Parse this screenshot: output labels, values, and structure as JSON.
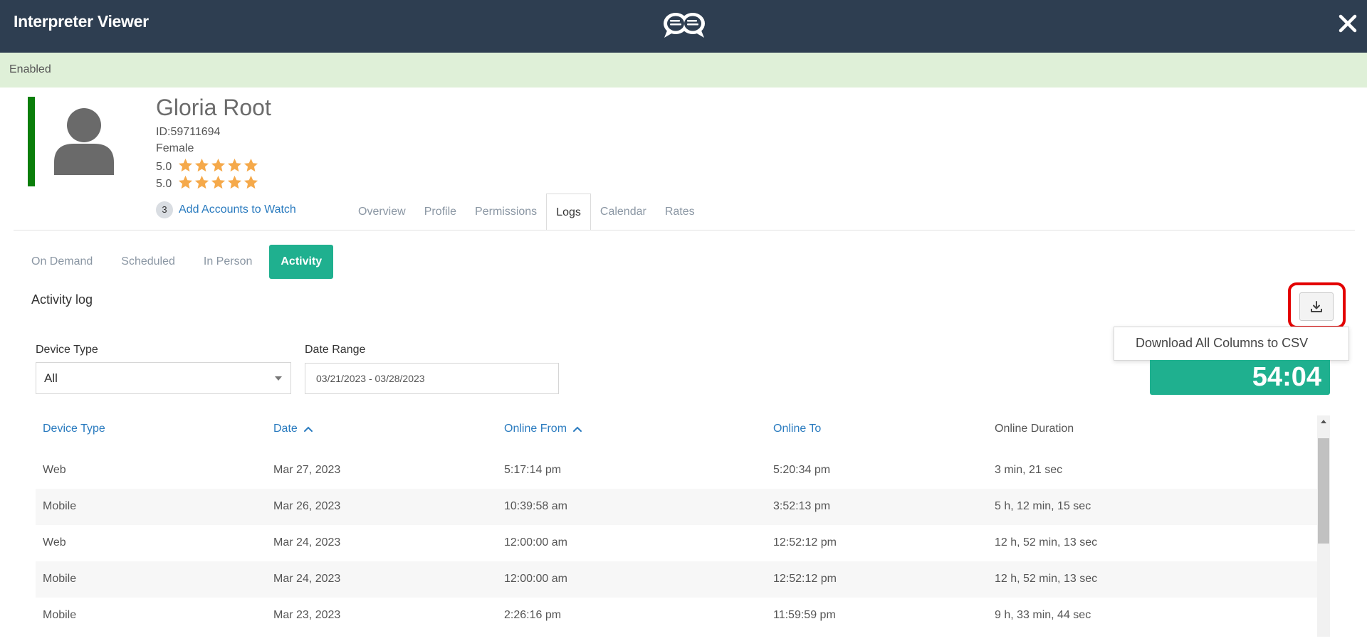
{
  "header": {
    "title": "Interpreter Viewer",
    "logo_icon": "chat-bubbles-logo-icon",
    "close_icon": "close-icon",
    "background": "#2e3e51"
  },
  "status": {
    "label": "Enabled",
    "background": "#dff0d8"
  },
  "profile": {
    "name": "Gloria Root",
    "id_label": "ID:",
    "id_value": "59711694",
    "gender": "Female",
    "ratings": [
      {
        "value": "5.0",
        "stars": 5
      },
      {
        "value": "5.0",
        "stars": 5
      }
    ],
    "watch_count": "3",
    "watch_label": "Add Accounts to Watch",
    "status_color": "#0a7e0a"
  },
  "tabs": [
    {
      "label": "Overview",
      "active": false
    },
    {
      "label": "Profile",
      "active": false
    },
    {
      "label": "Permissions",
      "active": false
    },
    {
      "label": "Logs",
      "active": true
    },
    {
      "label": "Calendar",
      "active": false
    },
    {
      "label": "Rates",
      "active": false
    }
  ],
  "subtabs": [
    {
      "label": "On Demand",
      "active": false
    },
    {
      "label": "Scheduled",
      "active": false
    },
    {
      "label": "In Person",
      "active": false
    },
    {
      "label": "Activity",
      "active": true
    }
  ],
  "section": {
    "title": "Activity log",
    "download_menu_item": "Download All Columns to CSV",
    "total": "54:04",
    "accent": "#1fb08f"
  },
  "filters": {
    "device_type_label": "Device Type",
    "device_type_value": "All",
    "date_range_label": "Date Range",
    "date_range_value": "03/21/2023 - 03/28/2023"
  },
  "table": {
    "columns": [
      "Device Type",
      "Date",
      "Online From",
      "Online To",
      "Online Duration"
    ],
    "rows": [
      [
        "Web",
        "Mar 27, 2023",
        "5:17:14 pm",
        "5:20:34 pm",
        "3 min, 21 sec"
      ],
      [
        "Mobile",
        "Mar 26, 2023",
        "10:39:58 am",
        "3:52:13 pm",
        "5 h, 12 min, 15 sec"
      ],
      [
        "Web",
        "Mar 24, 2023",
        "12:00:00 am",
        "12:52:12 pm",
        "12 h, 52 min, 13 sec"
      ],
      [
        "Mobile",
        "Mar 24, 2023",
        "12:00:00 am",
        "12:52:12 pm",
        "12 h, 52 min, 13 sec"
      ],
      [
        "Mobile",
        "Mar 23, 2023",
        "2:26:16 pm",
        "11:59:59 pm",
        "9 h, 33 min, 44 sec"
      ]
    ]
  }
}
